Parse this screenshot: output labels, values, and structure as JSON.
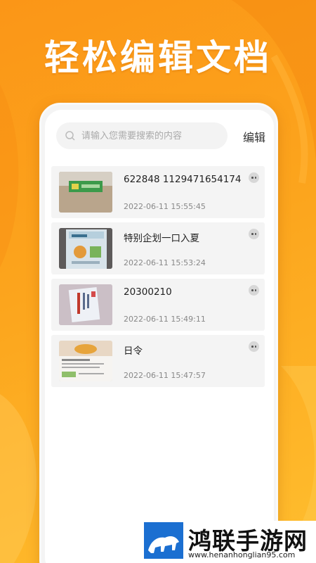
{
  "headline": "轻松编辑文档",
  "search": {
    "placeholder": "请输入您需要搜索的内容"
  },
  "edit_label": "编辑",
  "documents": [
    {
      "title": "622848 1129471654174",
      "time": "2022-06-11 15:55:45"
    },
    {
      "title": "特别企划一口入夏",
      "time": "2022-06-11 15:53:24"
    },
    {
      "title": "20300210",
      "time": "2022-06-11 15:49:11"
    },
    {
      "title": "日令",
      "time": "2022-06-11 15:47:57"
    }
  ],
  "watermark": {
    "title": "鸿联手游网",
    "url": "www.henanhonglian95.com"
  },
  "colors": {
    "accent": "#f79a16",
    "card_bg": "#f4f4f4",
    "text": "#222222",
    "muted": "#888888"
  },
  "icons": {
    "search": "search-icon",
    "more": "more-icon"
  }
}
